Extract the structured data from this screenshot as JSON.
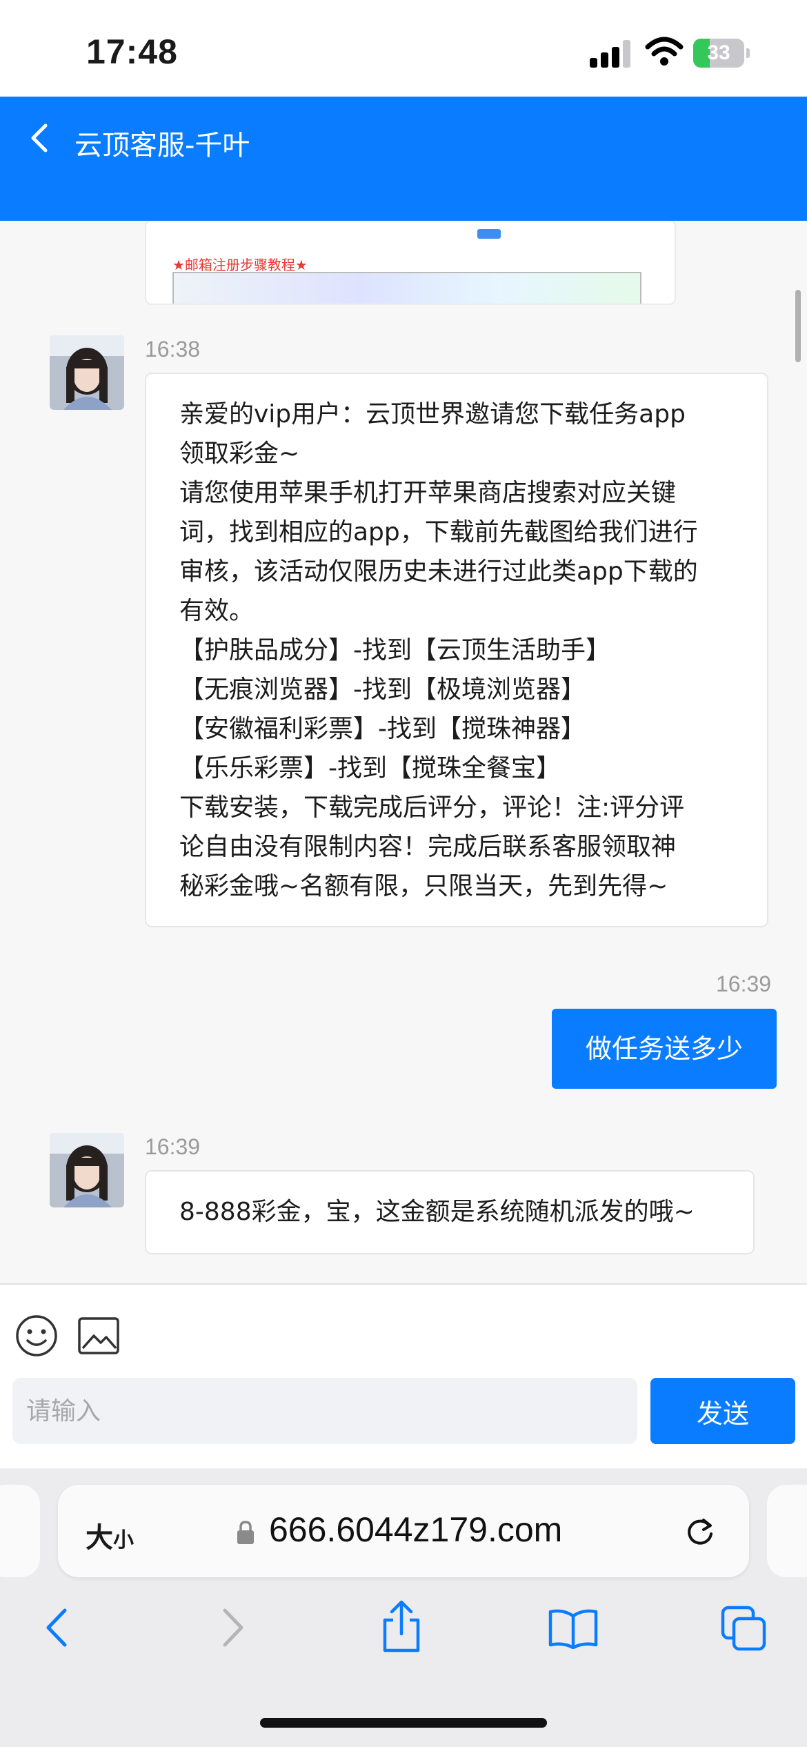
{
  "status_bar": {
    "time": "17:48",
    "battery_level": "33",
    "signal_icon": "cellular-signal-icon",
    "wifi_icon": "wifi-icon",
    "battery_icon": "battery-charging-icon"
  },
  "header": {
    "title": "云顶客服-千叶",
    "back_icon": "chevron-left-icon",
    "background_color": "#0a7cff"
  },
  "chat": {
    "preview_card": {
      "label": "★邮箱注册步骤教程★"
    },
    "messages": [
      {
        "time": "16:38",
        "side": "left",
        "lines": [
          "亲爱的vip用户：云顶世界邀请您下载任务app",
          "领取彩金~",
          "请您使用苹果手机打开苹果商店搜索对应关键",
          "词，找到相应的app，下载前先截图给我们进行",
          "审核，该活动仅限历史未进行过此类app下载的",
          "有效。",
          "【护肤品成分】-找到【云顶生活助手】",
          "【无痕浏览器】-找到【极境浏览器】",
          "【安徽福利彩票】-找到【搅珠神器】",
          "【乐乐彩票】-找到【搅珠全餐宝】",
          "下载安装，下载完成后评分，评论！注:评分评",
          "论自由没有限制内容！完成后联系客服领取神",
          "秘彩金哦~名额有限，只限当天，先到先得~"
        ]
      },
      {
        "time": "16:39",
        "side": "right",
        "text": "做任务送多少"
      },
      {
        "time": "16:39",
        "side": "left",
        "text": "8-888彩金，宝，这金额是系统随机派发的哦~"
      }
    ]
  },
  "composer": {
    "emoji_icon": "emoji-icon",
    "image_icon": "image-icon",
    "placeholder": "请输入",
    "send_label": "发送"
  },
  "browser": {
    "text_size_big": "大",
    "text_size_small": "小",
    "url": "666.6044z179.com",
    "lock_icon": "lock-icon",
    "reload_icon": "reload-icon",
    "toolbar_icons": [
      "back-arrow-icon",
      "forward-arrow-icon",
      "share-icon",
      "bookmarks-icon",
      "tabs-icon"
    ]
  }
}
